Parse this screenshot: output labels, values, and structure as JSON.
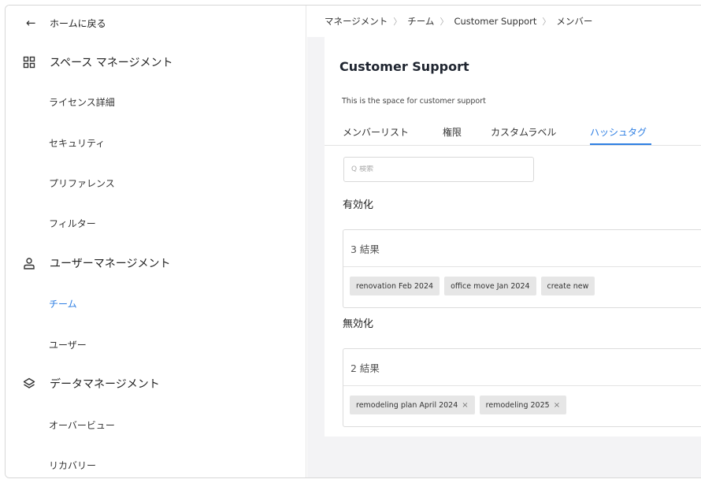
{
  "sidebar": {
    "back_label": "ホームに戻る",
    "sections": [
      {
        "label": "スペース マネージメント",
        "icon": "grid-icon",
        "items": [
          "ライセンス詳細",
          "セキュリティ",
          "プリファレンス",
          "フィルター"
        ]
      },
      {
        "label": "ユーザーマネージメント",
        "icon": "user-icon",
        "items": [
          "チーム",
          "ユーザー"
        ]
      },
      {
        "label": "データマネージメント",
        "icon": "layers-icon",
        "items": [
          "オーバービュー",
          "リカバリー"
        ]
      }
    ],
    "active_item": "チーム"
  },
  "breadcrumb": [
    "マネージメント",
    "チーム",
    "Customer Support",
    "メンバー"
  ],
  "page": {
    "title": "Customer Support",
    "description": "This is the space for customer support"
  },
  "tabs": [
    "メンバーリスト",
    "権限",
    "カスタムラベル",
    "ハッシュタグ"
  ],
  "active_tab": "ハッシュタグ",
  "search": {
    "icon": "Q",
    "placeholder": "検索"
  },
  "enabled": {
    "title": "有効化",
    "count_label": "3 結果",
    "tags": [
      "renovation Feb 2024",
      "office move Jan 2024",
      "create new"
    ]
  },
  "disabled": {
    "title": "無効化",
    "count_label": "2 結果",
    "tags": [
      "remodeling plan April 2024",
      "remodeling 2025"
    ],
    "remove_glyph": "×"
  },
  "colors": {
    "accent": "#2f7fe3",
    "tag_bg": "#e6e6e6",
    "content_bg": "#f3f3f5"
  }
}
